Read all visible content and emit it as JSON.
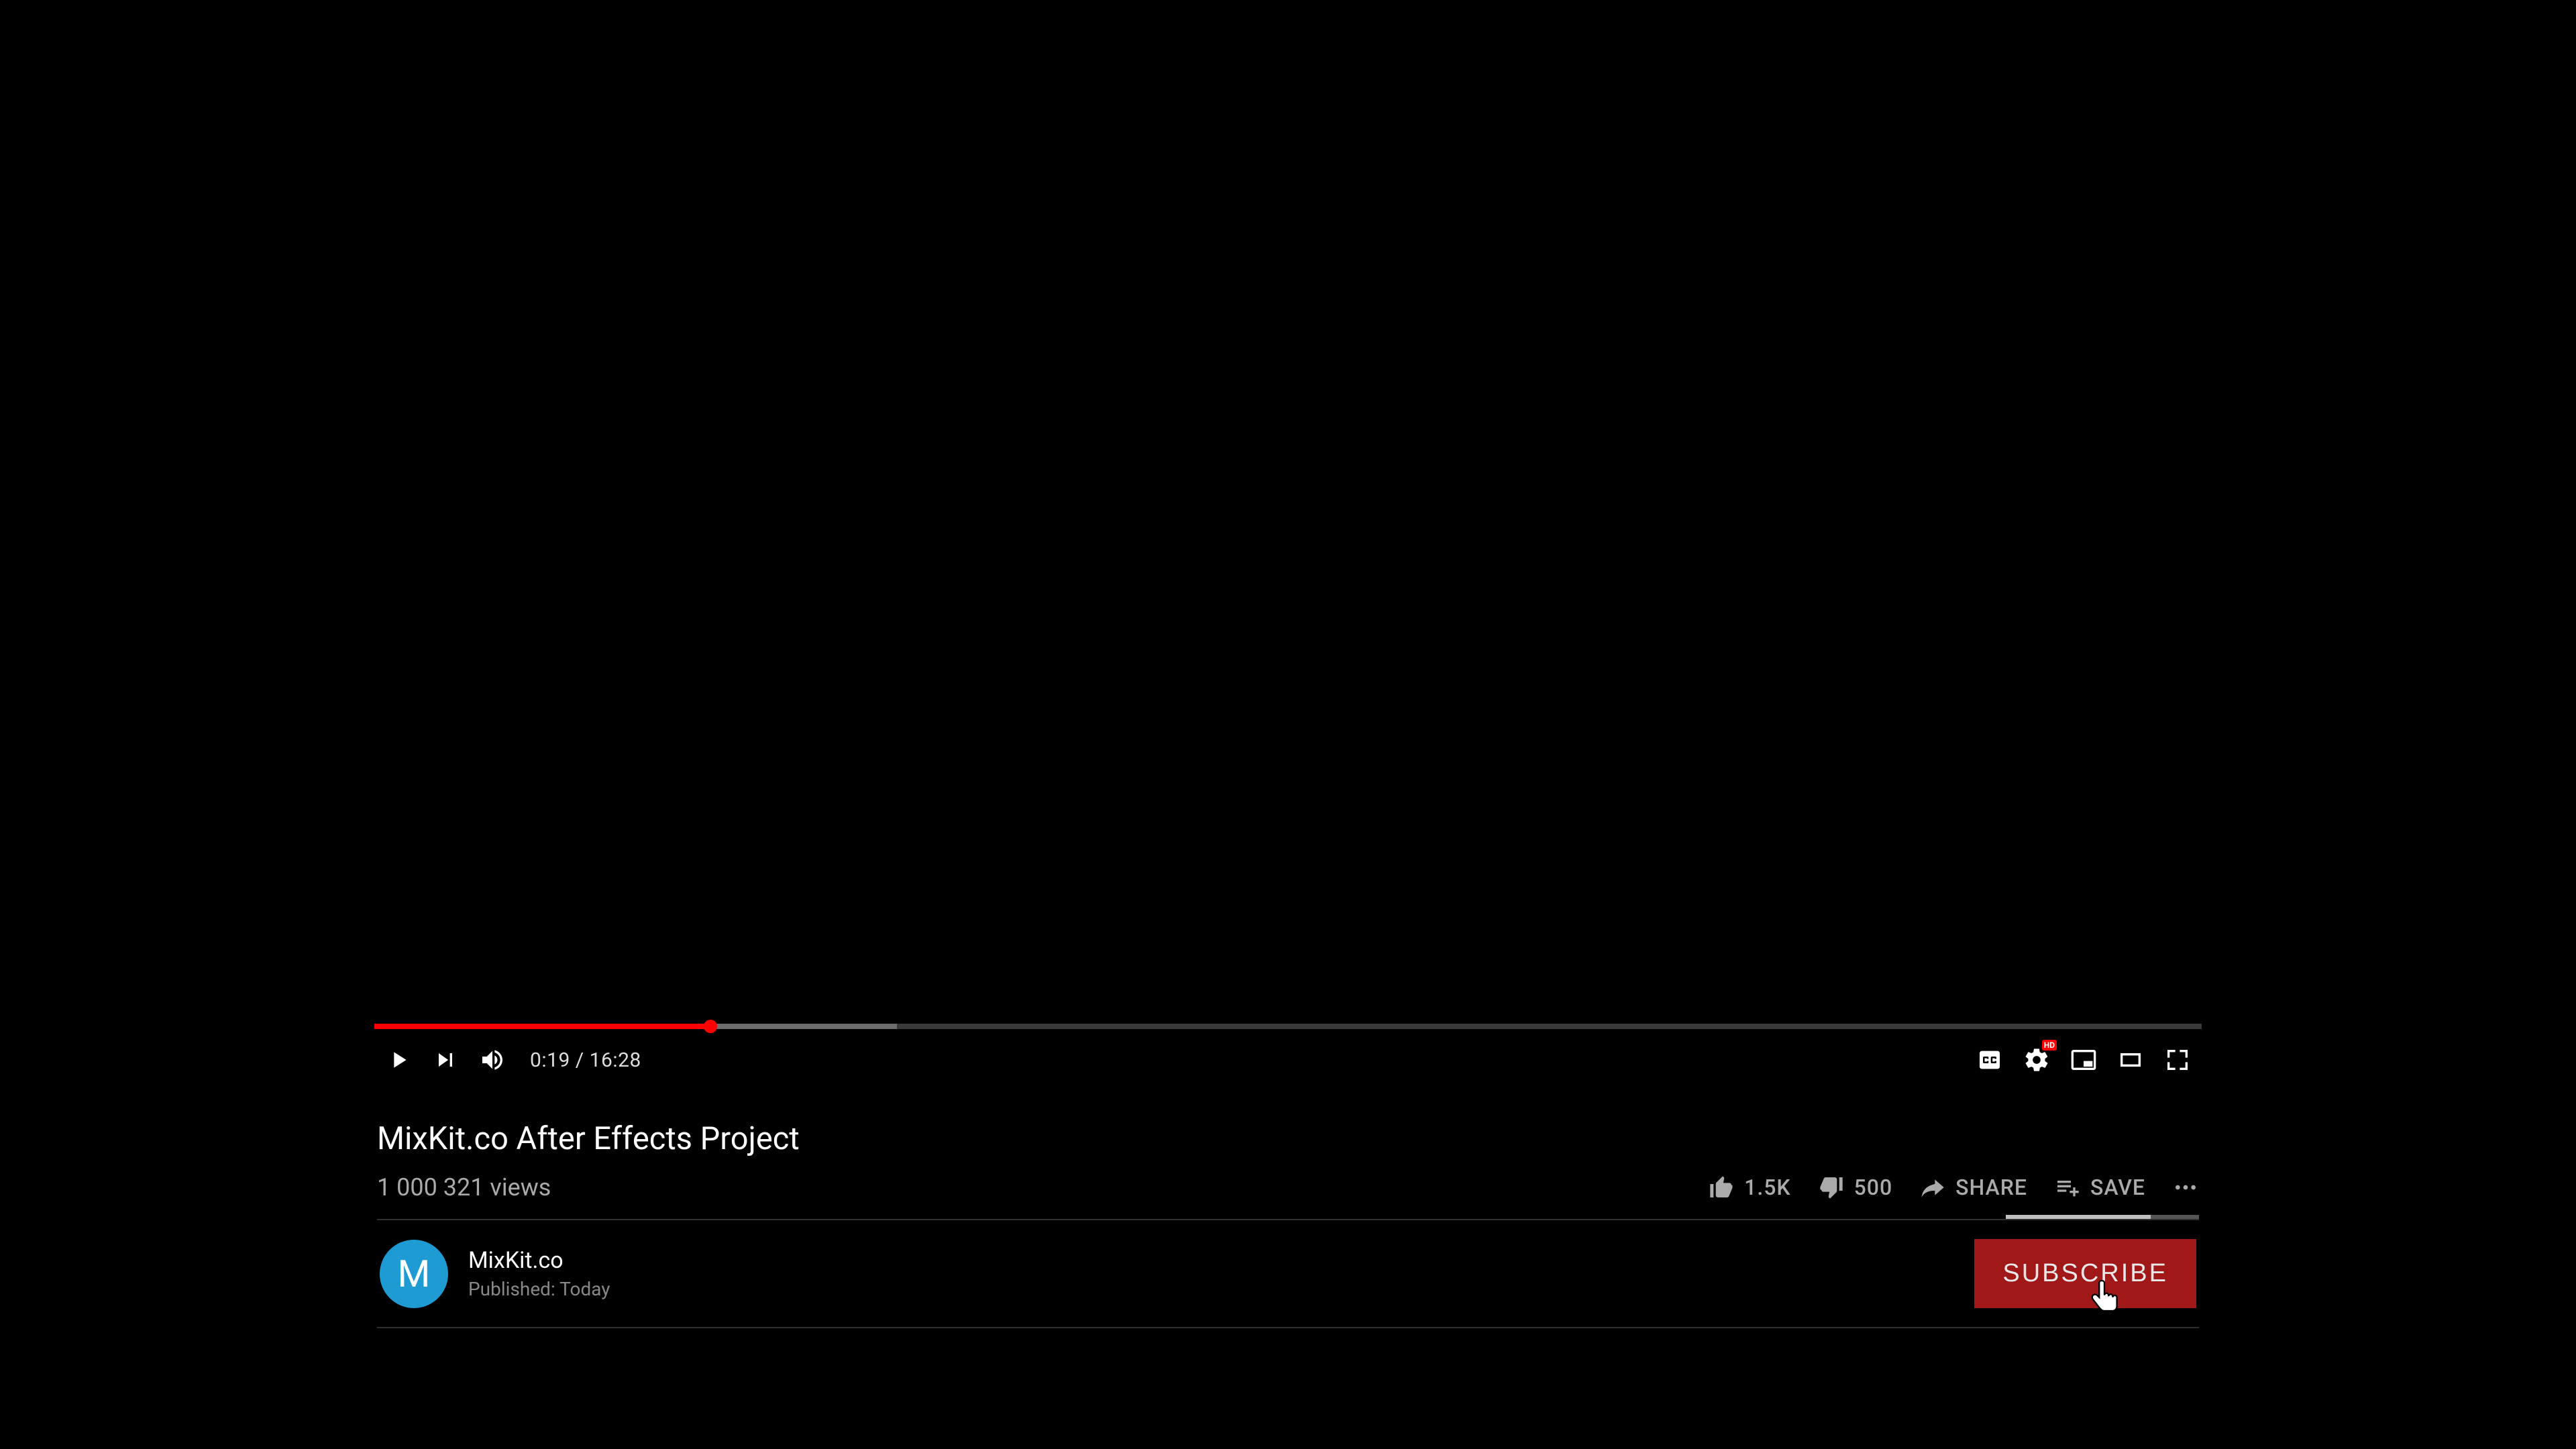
{
  "player": {
    "current_time": "0:19",
    "duration": "16:28",
    "time_display": "0:19 / 16:28",
    "progress_played_pct": 18.4,
    "progress_buffered_pct": 28.6,
    "quality_badge": "HD"
  },
  "video": {
    "title": "MixKit.co After Effects Project",
    "views": "1 000 321 views"
  },
  "actions": {
    "likes": "1.5K",
    "dislikes": "500",
    "share_label": "SHARE",
    "save_label": "SAVE",
    "like_ratio_pct": 75
  },
  "channel": {
    "avatar_letter": "M",
    "avatar_color": "#1f9bd4",
    "name": "MixKit.co",
    "published": "Published: Today"
  },
  "subscribe": {
    "label": "SUBSCRIBE",
    "bg": "#a01818"
  }
}
